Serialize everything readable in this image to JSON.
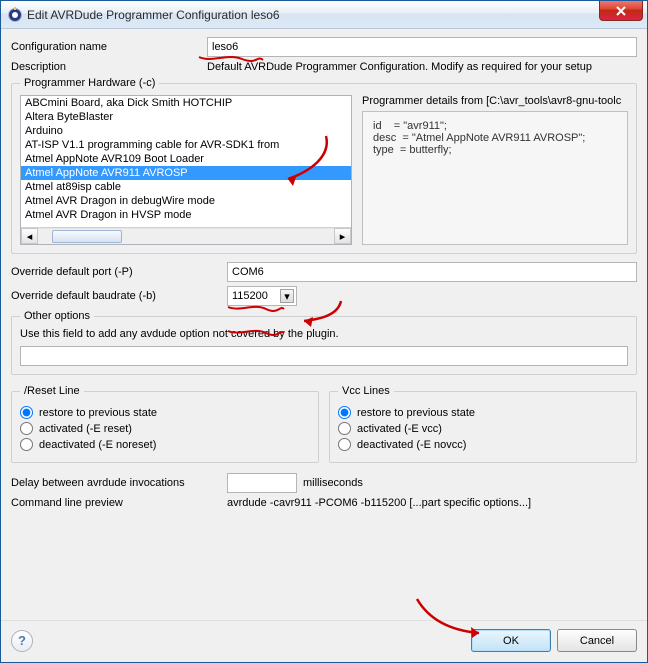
{
  "window": {
    "title": "Edit AVRDude Programmer Configuration leso6"
  },
  "labels": {
    "config_name": "Configuration name",
    "description": "Description",
    "hw_legend": "Programmer Hardware (-c)",
    "details_label": "Programmer details from [C:\\avr_tools\\avr8-gnu-toolc",
    "override_port": "Override default port (-P)",
    "override_baud": "Override default baudrate (-b)",
    "other_legend": "Other options",
    "other_hint": "Use this field to add any avdude option not covered by the plugin.",
    "reset_legend": "/Reset Line",
    "vcc_legend": "Vcc Lines",
    "delay": "Delay between avrdude invocations",
    "delay_unit": "milliseconds",
    "cmd_preview": "Command line preview"
  },
  "values": {
    "config_name": "leso6",
    "description": "Default AVRDude Programmer Configuration. Modify as required for your setup",
    "port": "COM6",
    "baud": "115200",
    "other_opts": "",
    "delay_ms": "",
    "cmd_preview": "avrdude -cavr911 -PCOM6 -b115200  [...part specific options...]"
  },
  "hw_list": {
    "items": [
      "ABCmini Board, aka Dick Smith HOTCHIP",
      "Altera ByteBlaster",
      "Arduino",
      "AT-ISP V1.1 programming cable for AVR-SDK1 from",
      "Atmel AppNote AVR109 Boot Loader",
      "Atmel AppNote AVR911 AVROSP",
      "Atmel at89isp cable",
      "Atmel AVR Dragon in debugWire mode",
      "Atmel AVR Dragon in HVSP mode"
    ],
    "selected_index": 5
  },
  "details": {
    "lines": [
      "id    = \"avr911\";",
      "desc  = \"Atmel AppNote AVR911 AVROSP\";",
      "type  = butterfly;"
    ]
  },
  "reset_opts": {
    "o0": "restore to previous state",
    "o1": "activated  (-E reset)",
    "o2": "deactivated (-E noreset)",
    "selected": 0
  },
  "vcc_opts": {
    "o0": "restore to previous state",
    "o1": "activated  (-E vcc)",
    "o2": "deactivated (-E novcc)",
    "selected": 0
  },
  "buttons": {
    "ok": "OK",
    "cancel": "Cancel"
  }
}
